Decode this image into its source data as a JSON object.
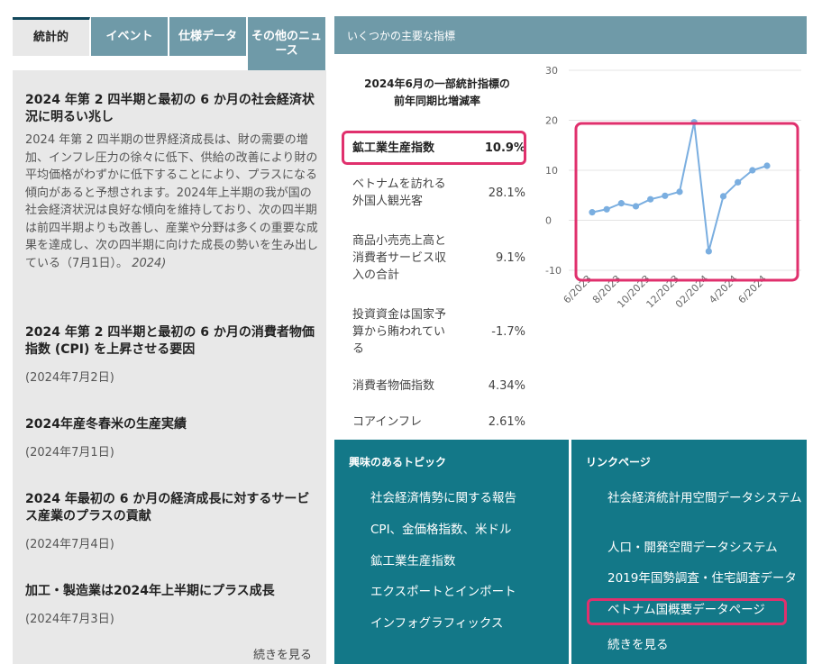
{
  "tabs": [
    {
      "label": "統計的",
      "active": true
    },
    {
      "label": "イベント",
      "active": false
    },
    {
      "label": "仕様データ",
      "active": false
    },
    {
      "label": "その他のニュース",
      "active": false
    }
  ],
  "news": [
    {
      "title": "2024 年第 2 四半期と最初の 6 か月の社会経済状況に明るい兆し",
      "summary": "2024 年第 2 四半期の世界経済成長は、財の需要の増加、インフレ圧力の徐々に低下、供給の改善により財の平均価格がわずかに低下することにより、プラスになる傾向があると予想されます。2024年上半期の我が国の社会経済状況は良好な傾向を維持しており、次の四半期は前四半期よりも改善し、産業や分野は多くの重要な成果を達成し、次の四半期に向けた成長の勢いを生み出している（7月1日）。",
      "summary_tail": "2024)"
    },
    {
      "title": "2024 年第 2 四半期と最初の 6 か月の消費者物価指数 (CPI) を上昇させる要因",
      "date": "(2024年7月2日)"
    },
    {
      "title": "2024年産冬春米の生産実績",
      "date": "(2024年7月1日)"
    },
    {
      "title": "2024 年最初の 6 か月の経済成長に対するサービス産業のプラスの貢献",
      "date": "(2024年7月4日)"
    },
    {
      "title": "加工・製造業は2024年上半期にプラス成長",
      "date": "(2024年7月3日)"
    }
  ],
  "more_left": "続きを見る",
  "indicators": {
    "header": "いくつかの主要な指標",
    "caption_line1": "2024年6月の一部統計指標の",
    "caption_line2": "前年同期比増減率",
    "rows": [
      {
        "name": "鉱工業生産指数",
        "value": "10.9%"
      },
      {
        "name": "ベトナムを訪れる外国人観光客",
        "value": "28.1%"
      },
      {
        "name": "商品小売売上高と消費者サービス収入の合計",
        "value": "9.1%"
      },
      {
        "name": "投資資金は国家予算から賄われている",
        "value": "-1.7%"
      },
      {
        "name": "消費者物価指数",
        "value": "4.34%"
      },
      {
        "name": "コアインフレ",
        "value": "2.61%"
      }
    ]
  },
  "chart_data": {
    "type": "line",
    "x": [
      "6/2023",
      "7/2023",
      "8/2023",
      "9/2023",
      "10/2023",
      "11/2023",
      "12/2023",
      "1/2024",
      "2/2024",
      "3/2024",
      "4/2024",
      "5/2024",
      "6/2024"
    ],
    "tick_labels": [
      "6/2023",
      "8/2023",
      "10/2023",
      "12/2023",
      "02/2024",
      "4/2024",
      "6/2024"
    ],
    "values": [
      1.6,
      2.2,
      3.4,
      2.8,
      4.2,
      4.9,
      5.7,
      19.6,
      -6.2,
      4.8,
      7.6,
      10.0,
      10.9
    ],
    "ylim": [
      -10,
      30
    ],
    "yticks": [
      -10,
      0,
      10,
      20,
      30
    ],
    "color": "#7aaee0",
    "grid": true
  },
  "topics": {
    "header": "興味のあるトピック",
    "items": [
      "社会経済情勢に関する報告",
      "CPI、金価格指数、米ドル",
      "鉱工業生産指数",
      "エクスポートとインポート",
      "インフォグラフィックス"
    ]
  },
  "links": {
    "header": "リンクページ",
    "items": [
      "社会経済統計用空間データシステム",
      "人口・開発空間データシステム",
      "2019年国勢調査・住宅調査データ",
      "ベトナム国概要データページ",
      "続きを見る"
    ]
  },
  "highlight_color": "#e0306d"
}
